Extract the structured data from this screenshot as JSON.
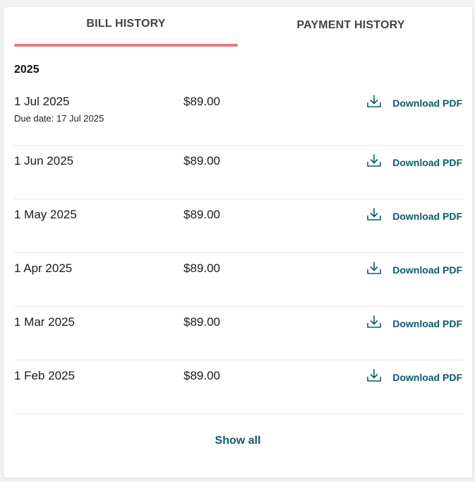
{
  "tabs": {
    "bill_history": "BILL HISTORY",
    "payment_history": "PAYMENT HISTORY",
    "active": "bill_history"
  },
  "year_heading": "2025",
  "bills": [
    {
      "date": "1 Jul 2025",
      "due": "Due date: 17 Jul 2025",
      "amount": "$89.00",
      "download": "Download PDF"
    },
    {
      "date": "1 Jun 2025",
      "due": "",
      "amount": "$89.00",
      "download": "Download PDF"
    },
    {
      "date": "1 May 2025",
      "due": "",
      "amount": "$89.00",
      "download": "Download PDF"
    },
    {
      "date": "1 Apr 2025",
      "due": "",
      "amount": "$89.00",
      "download": "Download PDF"
    },
    {
      "date": "1 Mar 2025",
      "due": "",
      "amount": "$89.00",
      "download": "Download PDF"
    },
    {
      "date": "1 Feb 2025",
      "due": "",
      "amount": "$89.00",
      "download": "Download PDF"
    }
  ],
  "show_all": "Show all",
  "colors": {
    "accent": "#e37b80",
    "link": "#0c5a6b"
  },
  "icons": {
    "download": "download-icon"
  }
}
